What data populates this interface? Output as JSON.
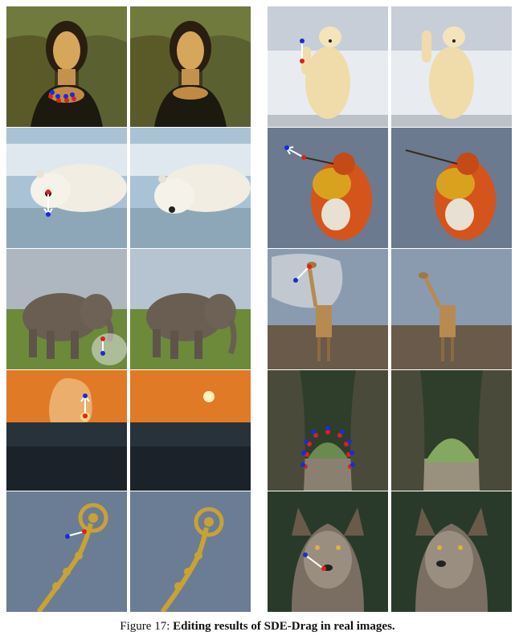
{
  "caption": {
    "label": "Figure 17:",
    "text": "Editing results of SDE-Drag in real images."
  },
  "rows": [
    {
      "left": "mona-lisa",
      "right": "polar-bear-standing"
    },
    {
      "left": "polar-bear-lying",
      "right": "hummingbird"
    },
    {
      "left": "elephant",
      "right": "giraffe"
    },
    {
      "left": "sunset",
      "right": "tree-tunnel"
    },
    {
      "left": "fiddlehead",
      "right": "wolf"
    }
  ],
  "colors": {
    "handle_point": "#e0201b",
    "target_point": "#1b2bd8",
    "drag_arrow": "#ffffff",
    "mask": "#f2f2f2"
  }
}
